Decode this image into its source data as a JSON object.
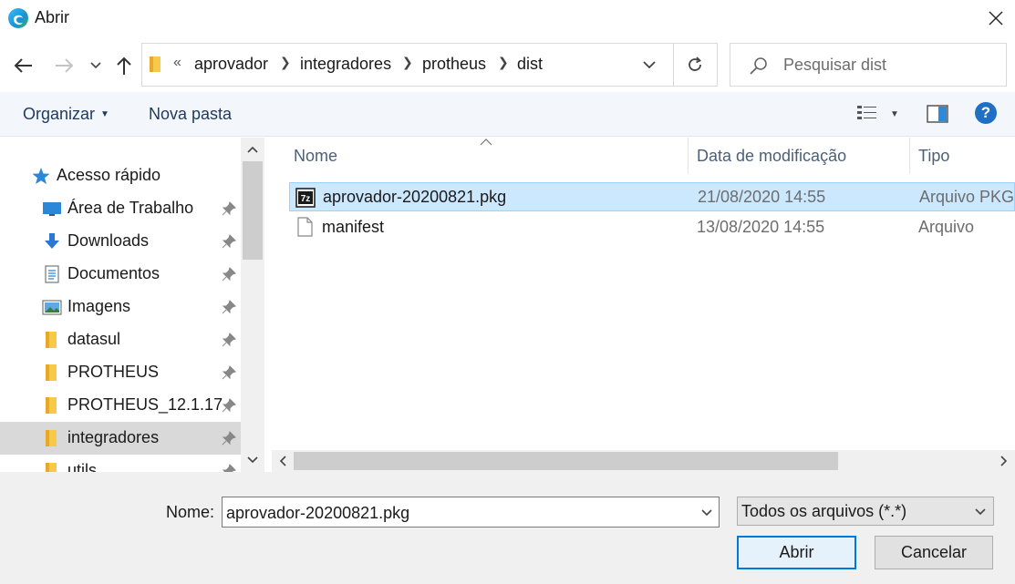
{
  "window": {
    "title": "Abrir",
    "close_icon": "close-icon",
    "app_icon": "edge-icon"
  },
  "address": {
    "overflow": "«",
    "crumbs": [
      "aprovador",
      "integradores",
      "protheus",
      "dist"
    ],
    "search_placeholder": "Pesquisar dist"
  },
  "toolbar": {
    "organize_label": "Organizar",
    "new_folder_label": "Nova pasta",
    "help_label": "?"
  },
  "sidebar": {
    "items": [
      {
        "label": "Acesso rápido",
        "icon": "star-icon",
        "pinned": false
      },
      {
        "label": "Área de Trabalho",
        "icon": "desktop-icon",
        "pinned": true
      },
      {
        "label": "Downloads",
        "icon": "download-icon",
        "pinned": true
      },
      {
        "label": "Documentos",
        "icon": "document-icon",
        "pinned": true
      },
      {
        "label": "Imagens",
        "icon": "image-icon",
        "pinned": true
      },
      {
        "label": "datasul",
        "icon": "folder-icon",
        "pinned": true
      },
      {
        "label": "PROTHEUS",
        "icon": "folder-icon",
        "pinned": true
      },
      {
        "label": "PROTHEUS_12.1.17",
        "icon": "folder-icon",
        "pinned": true
      },
      {
        "label": "integradores",
        "icon": "folder-icon",
        "pinned": true,
        "selected": true
      },
      {
        "label": "utils",
        "icon": "folder-icon",
        "pinned": true
      }
    ]
  },
  "filelist": {
    "columns": [
      "Nome",
      "Data de modificação",
      "Tipo"
    ],
    "rows": [
      {
        "name": "aprovador-20200821.pkg",
        "date": "21/08/2020 14:55",
        "type": "Arquivo PKG",
        "icon": "7z-archive-icon",
        "selected": true
      },
      {
        "name": "manifest",
        "date": "13/08/2020 14:55",
        "type": "Arquivo",
        "icon": "blank-file-icon",
        "selected": false
      }
    ]
  },
  "footer": {
    "name_label": "Nome:",
    "name_value": "aprovador-20200821.pkg",
    "filetype_value": "Todos os arquivos (*.*)",
    "open_label": "Abrir",
    "cancel_label": "Cancelar"
  },
  "colors": {
    "accent": "#0078d7",
    "selection_bg": "#cce8ff",
    "toolbar_bg": "#f3f6fa",
    "footer_bg": "#f0f0f0"
  }
}
